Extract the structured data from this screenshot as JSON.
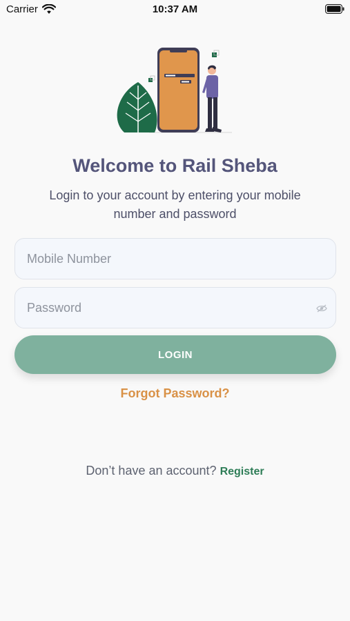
{
  "status_bar": {
    "carrier": "Carrier",
    "time": "10:37 AM",
    "wifi_icon": "wifi-icon",
    "battery_icon": "battery-icon"
  },
  "illustration": {
    "icon": "phone-login-illustration"
  },
  "header": {
    "title": "Welcome to Rail Sheba",
    "subtitle": "Login to your account by entering your mobile number and password"
  },
  "form": {
    "mobile_placeholder": "Mobile Number",
    "mobile_value": "",
    "password_placeholder": "Password",
    "password_value": "",
    "password_toggle_icon": "eye-slash-icon",
    "login_label": "LOGIN",
    "forgot_label": "Forgot Password?"
  },
  "footer": {
    "prompt": "Don’t have an account?",
    "register_label": "Register"
  },
  "colors": {
    "title": "#54557a",
    "primary_button": "#7fb19e",
    "forgot_link": "#d99146",
    "register_link": "#2e7d57",
    "leaf": "#1e6b48",
    "phone": "#e0964c"
  }
}
